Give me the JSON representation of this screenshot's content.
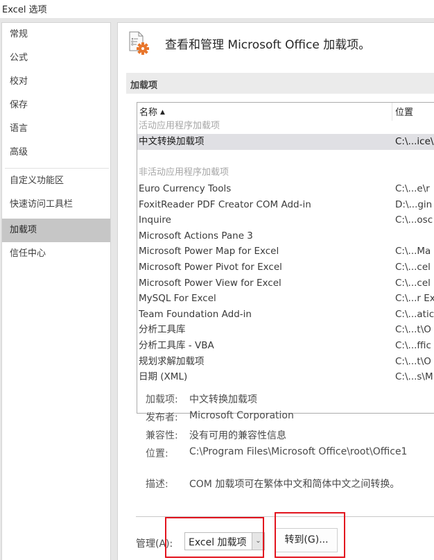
{
  "window": {
    "title": "Excel 选项"
  },
  "sidebar": {
    "items": [
      {
        "label": "常规",
        "active": false
      },
      {
        "label": "公式",
        "active": false
      },
      {
        "label": "校对",
        "active": false
      },
      {
        "label": "保存",
        "active": false
      },
      {
        "label": "语言",
        "active": false
      },
      {
        "label": "高级",
        "active": false
      },
      {
        "label": "自定义功能区",
        "active": false
      },
      {
        "label": "快速访问工具栏",
        "active": false
      },
      {
        "label": "加载项",
        "active": true
      },
      {
        "label": "信任中心",
        "active": false
      }
    ]
  },
  "header": {
    "icon": "addins-gear-document-icon",
    "title": "查看和管理 Microsoft Office 加载项。"
  },
  "section": {
    "title": "加载项"
  },
  "addins_table": {
    "columns": {
      "name": "名称",
      "sort_indicator": "▲",
      "location": "位置"
    },
    "rows": [
      {
        "type": "group",
        "name": "活动应用程序加载项",
        "location": ""
      },
      {
        "type": "item",
        "name": "中文转换加载项",
        "location": "C:\\...ice\\",
        "selected": true
      },
      {
        "type": "blank",
        "name": "",
        "location": ""
      },
      {
        "type": "group",
        "name": "非活动应用程序加载项",
        "location": ""
      },
      {
        "type": "item",
        "name": "Euro Currency Tools",
        "location": "C:\\...e\\r"
      },
      {
        "type": "item",
        "name": "FoxitReader PDF Creator COM Add-in",
        "location": "D:\\...gin"
      },
      {
        "type": "item",
        "name": "Inquire",
        "location": "C:\\...osc"
      },
      {
        "type": "item",
        "name": "Microsoft Actions Pane 3",
        "location": ""
      },
      {
        "type": "item",
        "name": "Microsoft Power Map for Excel",
        "location": "C:\\...Ma"
      },
      {
        "type": "item",
        "name": "Microsoft Power Pivot for Excel",
        "location": "C:\\...cel"
      },
      {
        "type": "item",
        "name": "Microsoft Power View for Excel",
        "location": "C:\\...cel"
      },
      {
        "type": "item",
        "name": "MySQL For Excel",
        "location": "C:\\...r Ex"
      },
      {
        "type": "item",
        "name": "Team Foundation Add-in",
        "location": "C:\\...atic"
      },
      {
        "type": "item",
        "name": "分析工具库",
        "location": "C:\\...t\\O"
      },
      {
        "type": "item",
        "name": "分析工具库 - VBA",
        "location": "C:\\...ffic"
      },
      {
        "type": "item",
        "name": "规划求解加载项",
        "location": "C:\\...t\\O"
      },
      {
        "type": "item",
        "name": "日期 (XML)",
        "location": "C:\\...s\\M"
      }
    ]
  },
  "details": {
    "addin": {
      "label": "加载项:",
      "value": "中文转换加载项"
    },
    "publisher": {
      "label": "发布者:",
      "value": "Microsoft Corporation"
    },
    "compat": {
      "label": "兼容性:",
      "value": "没有可用的兼容性信息"
    },
    "location": {
      "label": "位置:",
      "value": "C:\\Program Files\\Microsoft Office\\root\\Office1"
    },
    "description": {
      "label": "描述:",
      "value": "COM 加载项可在繁体中文和简体中文之间转换。"
    }
  },
  "manage": {
    "label": "管理(A):",
    "selected": "Excel 加载项",
    "dropdown_icon": "chevron-down-icon",
    "go_label": "转到(G)..."
  },
  "annotations": {
    "highlight_color": "#e2141e"
  }
}
